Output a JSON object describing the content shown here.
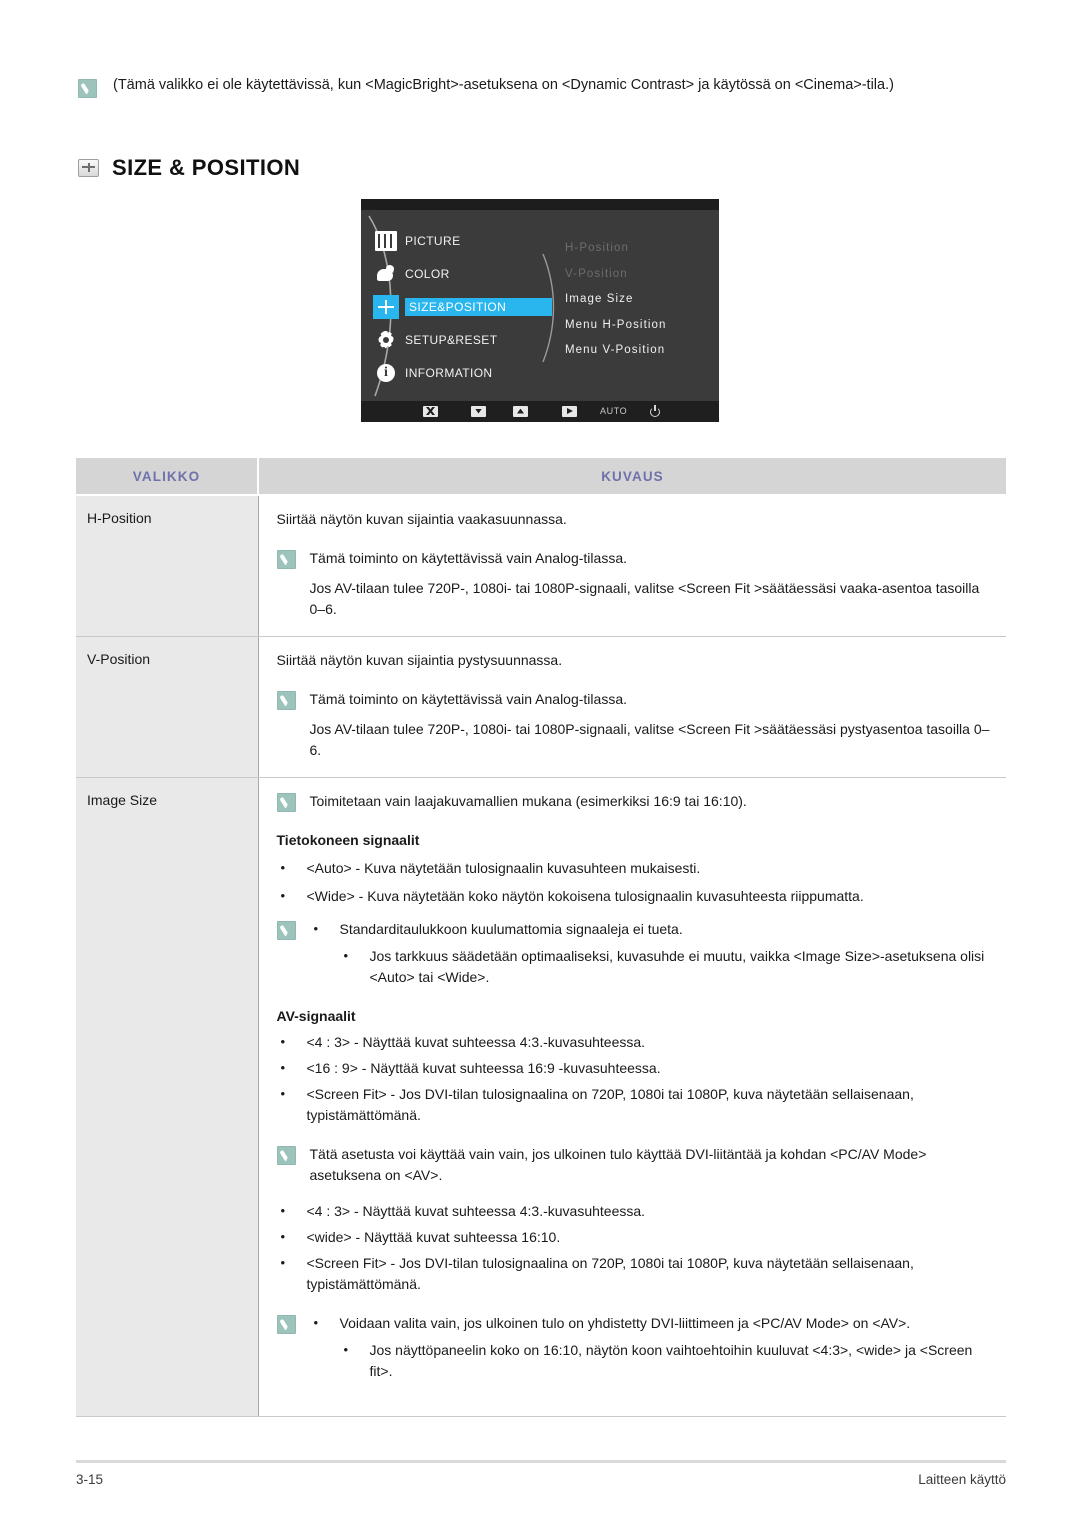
{
  "top_note": {
    "icon": "note-icon",
    "text": "(Tämä valikko ei ole käytettävissä, kun <MagicBright>-asetuksena on <Dynamic Contrast> ja käytössä on <Cinema>-tila.)"
  },
  "section": {
    "icon": "size-position-icon",
    "title": "SIZE & POSITION"
  },
  "osd": {
    "left_menu": [
      {
        "icon": "picture-icon",
        "label": "PICTURE",
        "selected": false
      },
      {
        "icon": "color-icon",
        "label": "COLOR",
        "selected": false
      },
      {
        "icon": "size-position-icon",
        "label": "SIZE&POSITION",
        "selected": true
      },
      {
        "icon": "gear-icon",
        "label": "SETUP&RESET",
        "selected": false
      },
      {
        "icon": "information-icon",
        "label": "INFORMATION",
        "selected": false
      }
    ],
    "right_menu": [
      {
        "label": "H-Position",
        "dimmed": true
      },
      {
        "label": "V-Position",
        "dimmed": true
      },
      {
        "label": "Image Size",
        "dimmed": false
      },
      {
        "label": "Menu H-Position",
        "dimmed": false
      },
      {
        "label": "Menu V-Position",
        "dimmed": false
      }
    ],
    "buttons": [
      {
        "icon": "close-icon",
        "label": ""
      },
      {
        "icon": "arrow-down-icon",
        "label": ""
      },
      {
        "icon": "arrow-up-icon",
        "label": ""
      },
      {
        "icon": "enter-icon",
        "label": ""
      },
      {
        "icon": "auto-label",
        "label": "AUTO"
      },
      {
        "icon": "power-icon",
        "label": ""
      }
    ],
    "accent_color": "#29b6ef",
    "background_color": "#3b3b3b"
  },
  "table": {
    "headers": {
      "menu": "VALIKKO",
      "description": "KUVAUS"
    },
    "header_text_color": "#6f71ab",
    "rows": [
      {
        "menu": "H-Position",
        "intro": "Siirtää näytön kuvan sijaintia vaakasuunnassa.",
        "note_main": "Tämä toiminto on käytettävissä vain Analog-tilassa.",
        "note_sub": "Jos AV-tilaan tulee 720P-, 1080i- tai 1080P-signaali, valitse <Screen Fit  >säätäessäsi vaaka-asentoa tasoilla 0–6."
      },
      {
        "menu": "V-Position",
        "intro": "Siirtää näytön kuvan sijaintia pystysuunnassa.",
        "note_main": "Tämä toiminto on käytettävissä vain Analog-tilassa.",
        "note_sub": "Jos AV-tilaan tulee 720P-, 1080i- tai 1080P-signaali, valitse <Screen Fit  >säätäessäsi pystyasentoa tasoilla 0–6."
      }
    ],
    "image_size": {
      "menu": "Image Size",
      "note_top": "Toimitetaan vain laajakuvamallien mukana (esimerkiksi 16:9 tai 16:10).",
      "pc_heading": "Tietokoneen signaalit",
      "pc_bullets": [
        "<Auto> - Kuva näytetään tulosignaalin kuvasuhteen mukaisesti.",
        "<Wide> - Kuva näytetään koko näytön kokoisena tulosignaalin kuvasuhteesta riippumatta."
      ],
      "pc_note_bullets": [
        "Standarditaulukkoon kuulumattomia signaaleja ei tueta.",
        "Jos tarkkuus säädetään optimaaliseksi, kuvasuhde ei muutu, vaikka <Image Size>-asetuksena olisi <Auto> tai <Wide>."
      ],
      "av_heading": "AV-signaalit",
      "av_bullets": [
        "<4 : 3> - Näyttää kuvat suhteessa 4:3.-kuvasuhteessa.",
        "<16 : 9> - Näyttää kuvat suhteessa 16:9 -kuvasuhteessa.",
        "<Screen Fit> - Jos DVI-tilan tulosignaalina on 720P, 1080i tai 1080P, kuva näytetään sellaisenaan, typistämättömänä."
      ],
      "av_note": "Tätä asetusta voi käyttää vain vain, jos ulkoinen tulo käyttää DVI-liitäntää ja kohdan <PC/AV Mode> asetuksena on <AV>.",
      "av_bullets2": [
        "<4 : 3> - Näyttää kuvat suhteessa 4:3.-kuvasuhteessa.",
        "<wide> - Näyttää kuvat suhteessa 16:10.",
        "<Screen Fit> - Jos DVI-tilan tulosignaalina on 720P, 1080i tai 1080P, kuva näytetään sellaisenaan, typistämättömänä."
      ],
      "final_note_bullets": [
        "Voidaan valita vain, jos ulkoinen tulo on yhdistetty DVI-liittimeen ja <PC/AV Mode> on <AV>.",
        "Jos näyttöpaneelin koko on 16:10, näytön koon vaihtoehtoihin kuuluvat <4:3>, <wide> ja <Screen fit>."
      ]
    }
  },
  "footer": {
    "page_number": "3-15",
    "chapter": "Laitteen käyttö"
  }
}
